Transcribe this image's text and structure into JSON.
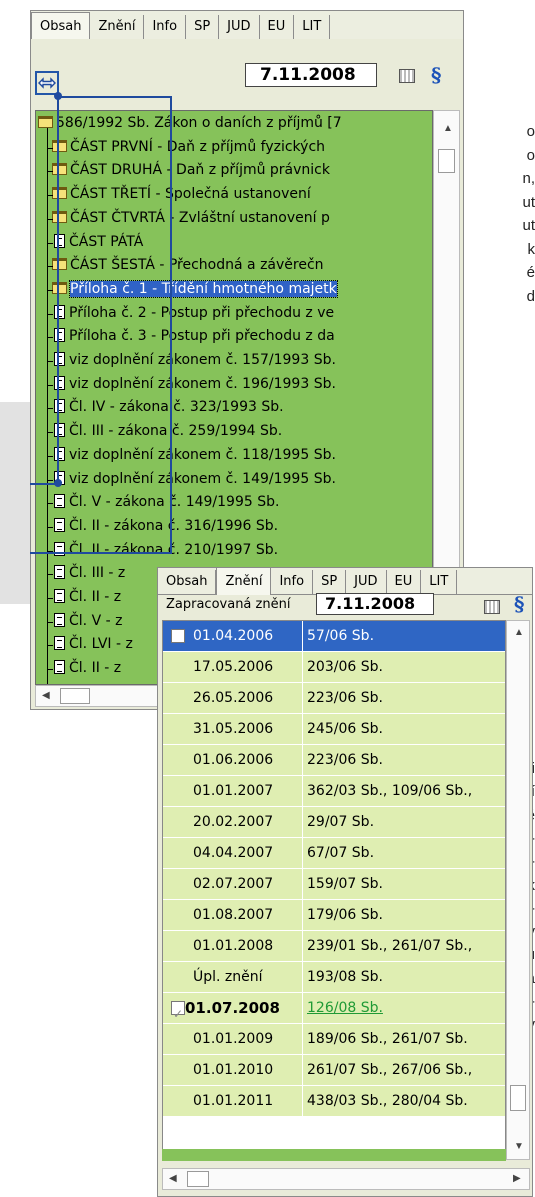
{
  "doc_text": {
    "fragments_top": [
      "o",
      "o",
      "n,",
      "ut",
      "ut",
      "k",
      "é",
      "d"
    ],
    "fragments_bottom": [
      "ti",
      "ní",
      "ě",
      "i-",
      "r-",
      "k",
      "i-",
      "v",
      "u",
      "a",
      "i-",
      "v"
    ]
  },
  "panel1": {
    "tabs": [
      "Obsah",
      "Znění",
      "Info",
      "SP",
      "JUD",
      "EU",
      "LIT"
    ],
    "date": "7.11.2008",
    "para_symbol": "§",
    "tree": [
      {
        "type": "folder",
        "label": "586/1992 Sb. Zákon o daních z příjmů [7"
      },
      {
        "type": "folder",
        "label": "ČÁST PRVNÍ - Daň z příjmů fyzických"
      },
      {
        "type": "folder",
        "label": "ČÁST DRUHÁ - Daň z příjmů právnick"
      },
      {
        "type": "folder",
        "label": "ČÁST TŘETÍ - Společná ustanovení"
      },
      {
        "type": "folder",
        "label": "ČÁST ČTVRTÁ - Zvláštní ustanovení p"
      },
      {
        "type": "doc",
        "label": "ČÁST PÁTÁ"
      },
      {
        "type": "folder",
        "label": "ČÁST ŠESTÁ - Přechodná a závěrečn"
      },
      {
        "type": "folder",
        "label": "Příloha č. 1 - Třídění hmotného majetk",
        "selected": true
      },
      {
        "type": "doc",
        "label": "Příloha č. 2 - Postup při přechodu z ve"
      },
      {
        "type": "doc",
        "label": "Příloha č. 3 - Postup při přechodu z da"
      },
      {
        "type": "doc",
        "label": "viz doplnění zákonem č. 157/1993 Sb."
      },
      {
        "type": "doc",
        "label": "viz doplnění zákonem č. 196/1993 Sb."
      },
      {
        "type": "doc",
        "label": "Čl. IV - zákona č. 323/1993 Sb."
      },
      {
        "type": "doc",
        "label": "Čl. III - zákona č. 259/1994 Sb."
      },
      {
        "type": "doc",
        "label": "viz doplnění zákonem č. 118/1995 Sb."
      },
      {
        "type": "doc",
        "label": "viz doplnění zákonem č. 149/1995 Sb."
      },
      {
        "type": "doc",
        "label": "Čl. V - zákona č. 149/1995 Sb."
      },
      {
        "type": "doc",
        "label": "Čl. II - zákona č. 316/1996 Sb."
      },
      {
        "type": "doc",
        "label": "Čl. II - zákona č. 210/1997 Sb."
      },
      {
        "type": "doc",
        "label": "Čl. III - z"
      },
      {
        "type": "doc",
        "label": "Čl. II - z"
      },
      {
        "type": "doc",
        "label": "Čl. V - z"
      },
      {
        "type": "doc",
        "label": "Čl. LVI - z"
      },
      {
        "type": "doc",
        "label": "Čl. II - z"
      }
    ]
  },
  "panel2": {
    "tabs": [
      "Obsah",
      "Znění",
      "Info",
      "SP",
      "JUD",
      "EU",
      "LIT"
    ],
    "header_label": "Zapracovaná znění",
    "date": "7.11.2008",
    "para_symbol": "§",
    "rows": [
      {
        "date": "01.04.2006",
        "ref": "57/06 Sb.",
        "selected": true,
        "checkbox": "unchecked"
      },
      {
        "date": "17.05.2006",
        "ref": "203/06 Sb."
      },
      {
        "date": "26.05.2006",
        "ref": "223/06 Sb."
      },
      {
        "date": "31.05.2006",
        "ref": "245/06 Sb."
      },
      {
        "date": "01.06.2006",
        "ref": "223/06 Sb."
      },
      {
        "date": "01.01.2007",
        "ref": "362/03 Sb., 109/06 Sb.,"
      },
      {
        "date": "20.02.2007",
        "ref": "29/07 Sb."
      },
      {
        "date": "04.04.2007",
        "ref": "67/07 Sb."
      },
      {
        "date": "02.07.2007",
        "ref": "159/07 Sb."
      },
      {
        "date": "01.08.2007",
        "ref": "179/06 Sb."
      },
      {
        "date": "01.01.2008",
        "ref": "239/01 Sb., 261/07 Sb.,"
      },
      {
        "date": "Úpl. znění",
        "ref": "193/08 Sb."
      },
      {
        "date": "01.07.2008",
        "ref": "126/08 Sb.",
        "bold": true,
        "checkbox": "checked"
      },
      {
        "date": "01.01.2009",
        "ref": "189/06 Sb., 261/07 Sb."
      },
      {
        "date": "01.01.2010",
        "ref": "261/07 Sb., 267/06 Sb.,"
      },
      {
        "date": "01.01.2011",
        "ref": "438/03 Sb., 280/04 Sb."
      }
    ]
  },
  "colors": {
    "tree_bg": "#86c25a",
    "grid_row": "#dfeeb2",
    "selection": "#2f66c4",
    "connector": "#1f4a9e",
    "link_green": "#1f9a35"
  }
}
